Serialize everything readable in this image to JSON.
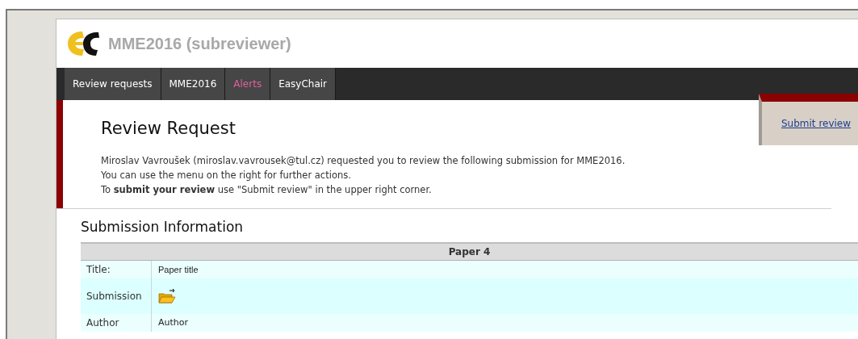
{
  "header": {
    "title": "MME2016 (subreviewer)"
  },
  "nav": {
    "tabs": [
      {
        "label": "Review requests",
        "kind": "normal"
      },
      {
        "label": "MME2016",
        "kind": "normal"
      },
      {
        "label": "Alerts",
        "kind": "alert"
      },
      {
        "label": "EasyChair",
        "kind": "normal"
      }
    ]
  },
  "side_menu": {
    "items": [
      "Submit review"
    ]
  },
  "page_title": "Review Request",
  "intro": [
    "Miroslav Vavroušek (miroslav.vavrousek@tul.cz) requested you to review the following submission for MME2016.",
    "You can use the menu on the right for further actions.",
    "To **submit your review** use \"Submit review\" in the upper right corner."
  ],
  "section_title": "Submission Information",
  "table": {
    "heading": "Paper 4",
    "rows": [
      {
        "label": "Title:",
        "kind": "text",
        "value": "Paper title"
      },
      {
        "label": "Submission",
        "kind": "file"
      },
      {
        "label": "Author",
        "kind": "text",
        "value": "Author"
      }
    ]
  }
}
